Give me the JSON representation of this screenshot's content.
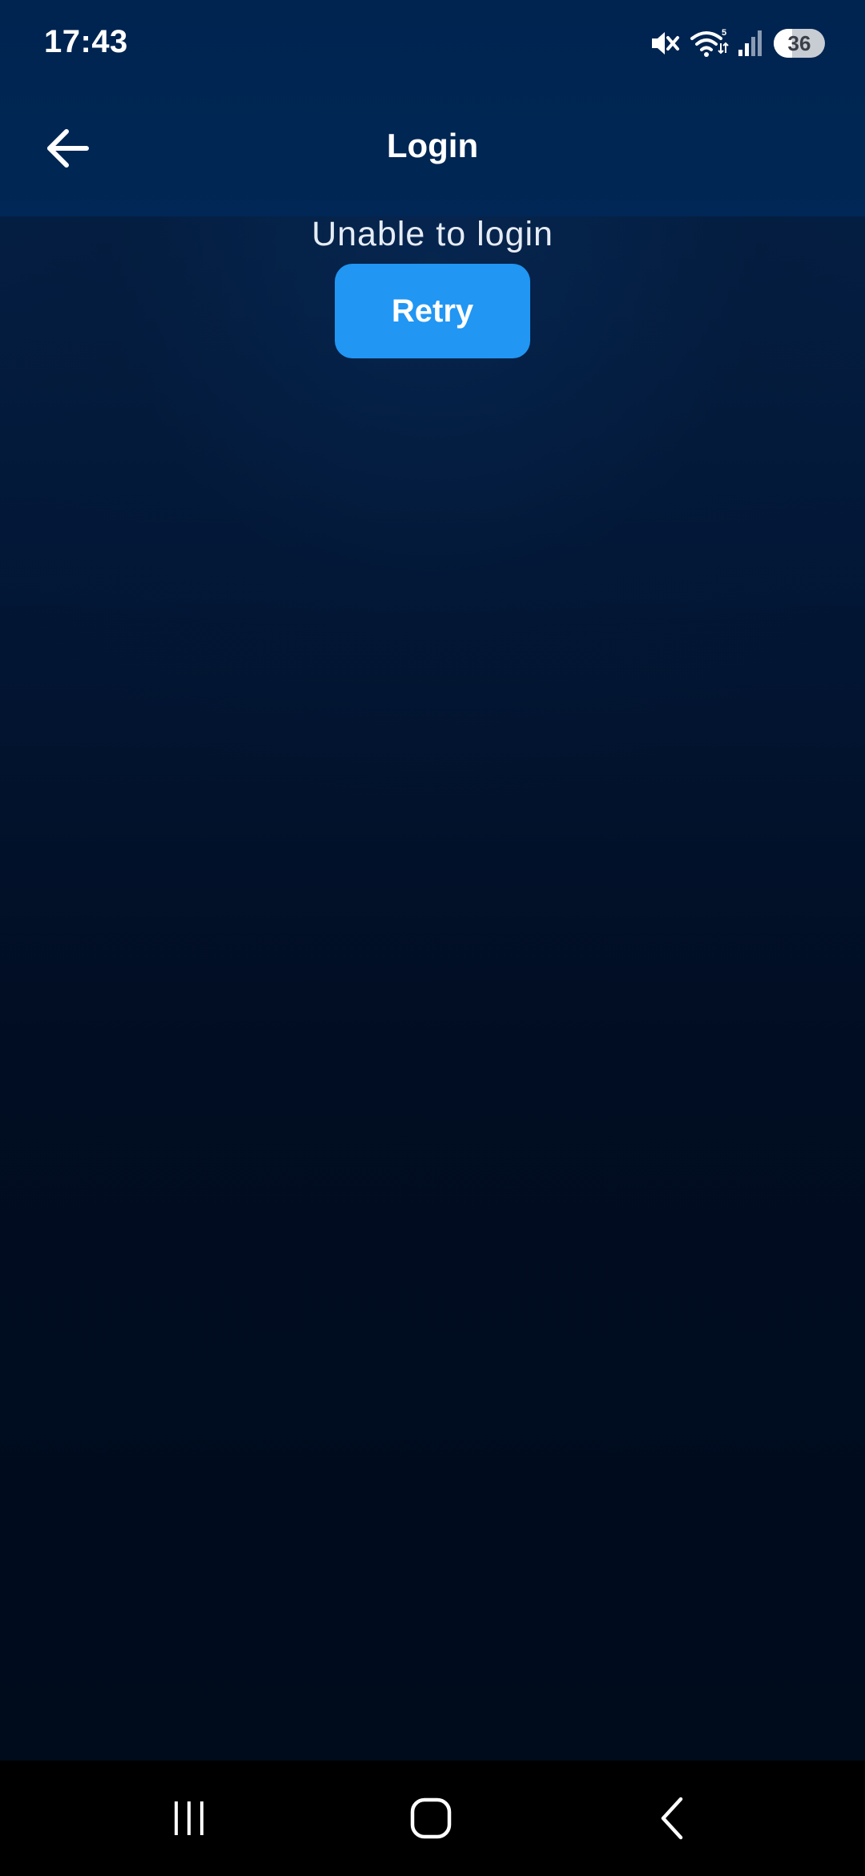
{
  "status_bar": {
    "time": "17:43",
    "battery_level": "36",
    "icons": [
      "mute-icon",
      "wifi-icon",
      "signal-icon",
      "battery-icon"
    ]
  },
  "app_bar": {
    "title": "Login",
    "back_icon": "arrow-left-icon"
  },
  "content": {
    "message": "Unable to login",
    "retry_label": "Retry"
  },
  "nav_bar": {
    "icons": [
      "recent-apps-icon",
      "home-icon",
      "back-icon"
    ]
  },
  "colors": {
    "top_bar": "#002450",
    "background": "#000e20",
    "accent_button": "#2196f3",
    "nav_bar": "#000000"
  }
}
